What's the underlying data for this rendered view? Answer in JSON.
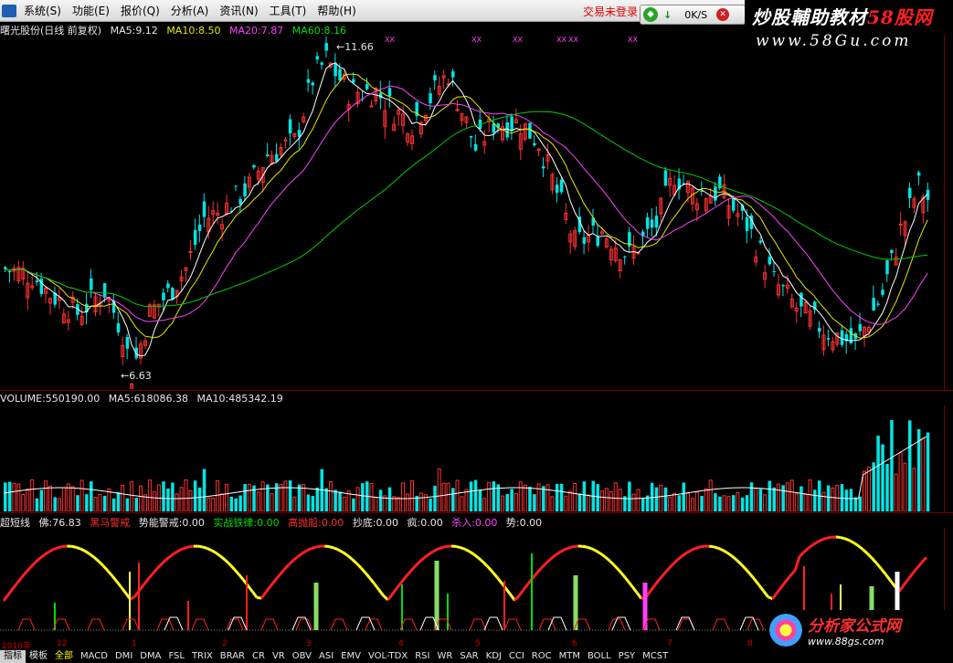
{
  "menubar": {
    "items": [
      "系统(S)",
      "功能(E)",
      "报价(Q)",
      "分析(A)",
      "资讯(N)",
      "工具(T)",
      "帮助(H)"
    ],
    "trade_status": "交易未登录",
    "quote_box": {
      "speed": "0K/S"
    }
  },
  "watermark_top": {
    "line1a": "炒股輔助教材",
    "line1b": "58股网",
    "line2": "www.58Gu.com"
  },
  "price_panel": {
    "stock": "曙光股份(日线 前复权)",
    "ma5": "MA5:9.12",
    "ma10": "MA10:8.50",
    "ma20": "MA20:7.87",
    "ma60": "MA60:8.16",
    "high_label": "11.66",
    "low_label": "6.63",
    "marker_x": "XX"
  },
  "volume_panel": {
    "volume": "VOLUME:550190.00",
    "ma5": "MA5:618086.38",
    "ma10": "MA10:485342.19"
  },
  "indicator_panel": {
    "name": "超短线",
    "fo": "佛:76.83",
    "heima": "黑马警戒",
    "shineng": "势能警戒:0.00",
    "shizhan": "实战铁律:0.00",
    "diaoyu": "高抛船:0.00",
    "chaodi": "抄底:0.00",
    "feng": "疯:0.00",
    "shaoru": "杀入:0.00",
    "shi": "势:0.00"
  },
  "date_labels": [
    "2010年",
    "12",
    "1",
    "2",
    "3",
    "4",
    "5",
    "6",
    "7",
    "8"
  ],
  "tabs": [
    "指标",
    "模板",
    "全部",
    "MACD",
    "DMI",
    "DMA",
    "FSL",
    "TRIX",
    "BRAR",
    "CR",
    "VR",
    "OBV",
    "ASI",
    "EMV",
    "VOL-TDX",
    "RSI",
    "WR",
    "SAR",
    "KDJ",
    "CCI",
    "ROC",
    "MTM",
    "BOLL",
    "PSY",
    "MCST"
  ],
  "watermark_bottom": {
    "line1": "分析家公式网",
    "line2": "www.88gs.com"
  },
  "colors": {
    "up": "#ff3030",
    "down": "#00e5e5",
    "ma5": "#ffffff",
    "ma10": "#e6e600",
    "ma20": "#ff40ff",
    "ma60": "#00cc00"
  }
}
